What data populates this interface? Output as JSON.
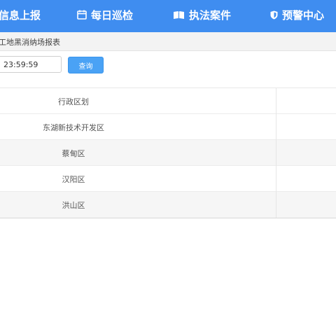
{
  "nav": {
    "items": [
      {
        "label": "信息上报",
        "icon": "report-icon"
      },
      {
        "label": "每日巡检",
        "icon": "calendar-icon"
      },
      {
        "label": "执法案件",
        "icon": "book-icon"
      },
      {
        "label": "预警中心",
        "icon": "shield-icon"
      }
    ],
    "background": "#3f8df0"
  },
  "breadcrumb": {
    "text": "工地黑消纳场报表"
  },
  "filter": {
    "time_value": "23:59:59",
    "query_label": "查询"
  },
  "table": {
    "header": "行政区划",
    "rows": [
      "东湖新技术开发区",
      "蔡甸区",
      "汉阳区",
      "洪山区"
    ]
  },
  "colors": {
    "accent": "#4aa2f5",
    "nav": "#3f8df0"
  }
}
